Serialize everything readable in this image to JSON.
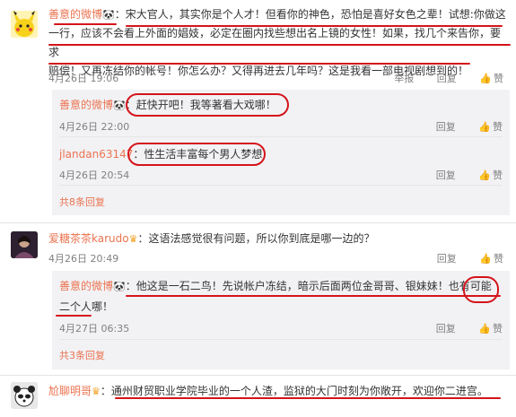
{
  "comments": [
    {
      "user": "善意的微博",
      "text_line1": "：宋大官人，其实你是个人才！但看你的神色，恐怕是喜好女色之辈！试想:你做这",
      "text_line2": "一行，应该不会看上外面的娼妓，必定在圈内找些想出名上镜的女性！如果，找几个来告你，要求",
      "text_line3": "赔偿！又再冻结你的帐号！你怎么办？又得再进去几年吗？这是我看一部电视剧想到的！",
      "time": "4月26日 19:06",
      "actions": [
        "举报",
        "回复",
        "赞"
      ],
      "replies": [
        {
          "user": "善意的微博",
          "text": "：赶快开吧！我等著看大戏哪！",
          "time": "4月26日 22:00",
          "actions": [
            "回复",
            "赞"
          ]
        },
        {
          "user": "jlandan63147",
          "text": "：性生活丰富每个男人梦想",
          "time": "4月26日 20:54",
          "actions": [
            "回复",
            "赞"
          ]
        }
      ],
      "more": "共8条回复"
    },
    {
      "user": "爱糖茶茶karudo",
      "text": "：这语法感觉很有问题，所以你到底是哪一边的？",
      "time": "4月26日 20:49",
      "actions": [
        "回复",
        "赞"
      ],
      "replies": [
        {
          "user": "善意的微博",
          "text_line1": "：他这是一石二鸟！先说帐户冻结，暗示后面两位金哥哥、银妹妹！也有可能",
          "text_line2": "二个人哪！",
          "time": "4月27日 06:35",
          "actions": [
            "回复",
            "赞"
          ]
        }
      ],
      "more": "共3条回复"
    },
    {
      "user": "尬聊明哥",
      "text": "：通州财贸职业学院毕业的一个人渣，监狱的大门时刻为你敞开，欢迎你二进宫。"
    }
  ],
  "colors": {
    "username": "#eb7350",
    "annotation": "#d4141a",
    "reply_bg": "#f2f2f5"
  }
}
